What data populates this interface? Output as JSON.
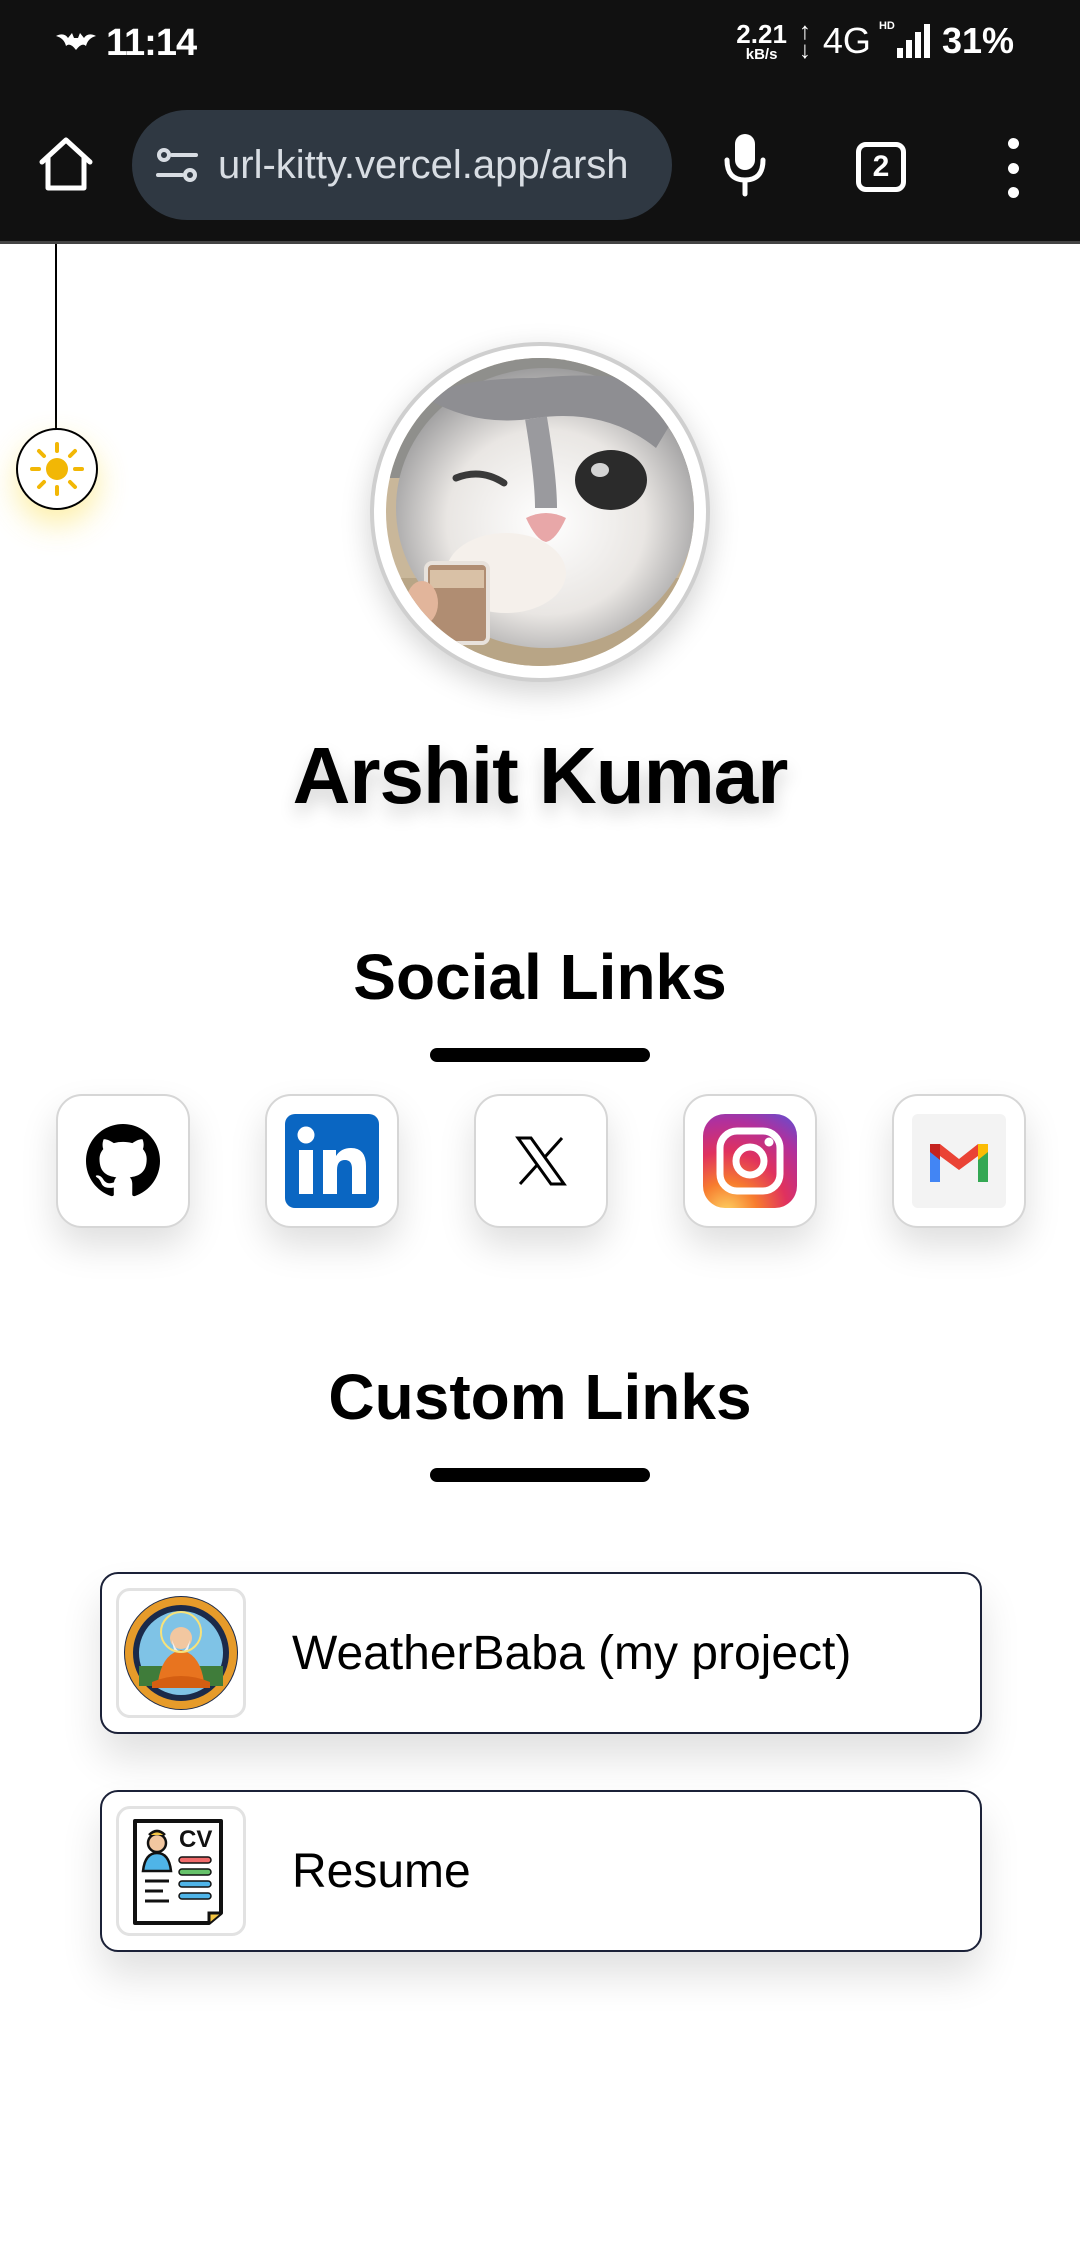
{
  "status_bar": {
    "time": "11:14",
    "net_speed_value": "2.21",
    "net_speed_unit": "kB/s",
    "network_type": "4G",
    "signal_label": "HD",
    "battery": "31%"
  },
  "browser": {
    "url": "url-kitty.vercel.app/arsh",
    "tab_count": "2"
  },
  "profile": {
    "name": "Arshit Kumar"
  },
  "social": {
    "title": "Social Links",
    "items": [
      {
        "name": "github",
        "icon": "github-icon"
      },
      {
        "name": "linkedin",
        "icon": "linkedin-icon"
      },
      {
        "name": "x",
        "icon": "x-icon"
      },
      {
        "name": "instagram",
        "icon": "instagram-icon"
      },
      {
        "name": "gmail",
        "icon": "gmail-icon"
      }
    ]
  },
  "custom": {
    "title": "Custom Links",
    "items": [
      {
        "label": "WeatherBaba (my project)",
        "icon": "weatherbaba-logo"
      },
      {
        "label": "Resume",
        "icon": "cv-icon"
      }
    ]
  },
  "colors": {
    "bar_bg": "#111111",
    "url_bg": "#2f3842",
    "sun": "#f2b705",
    "linkedin": "#0a66c2",
    "card_border": "#1b2138"
  }
}
